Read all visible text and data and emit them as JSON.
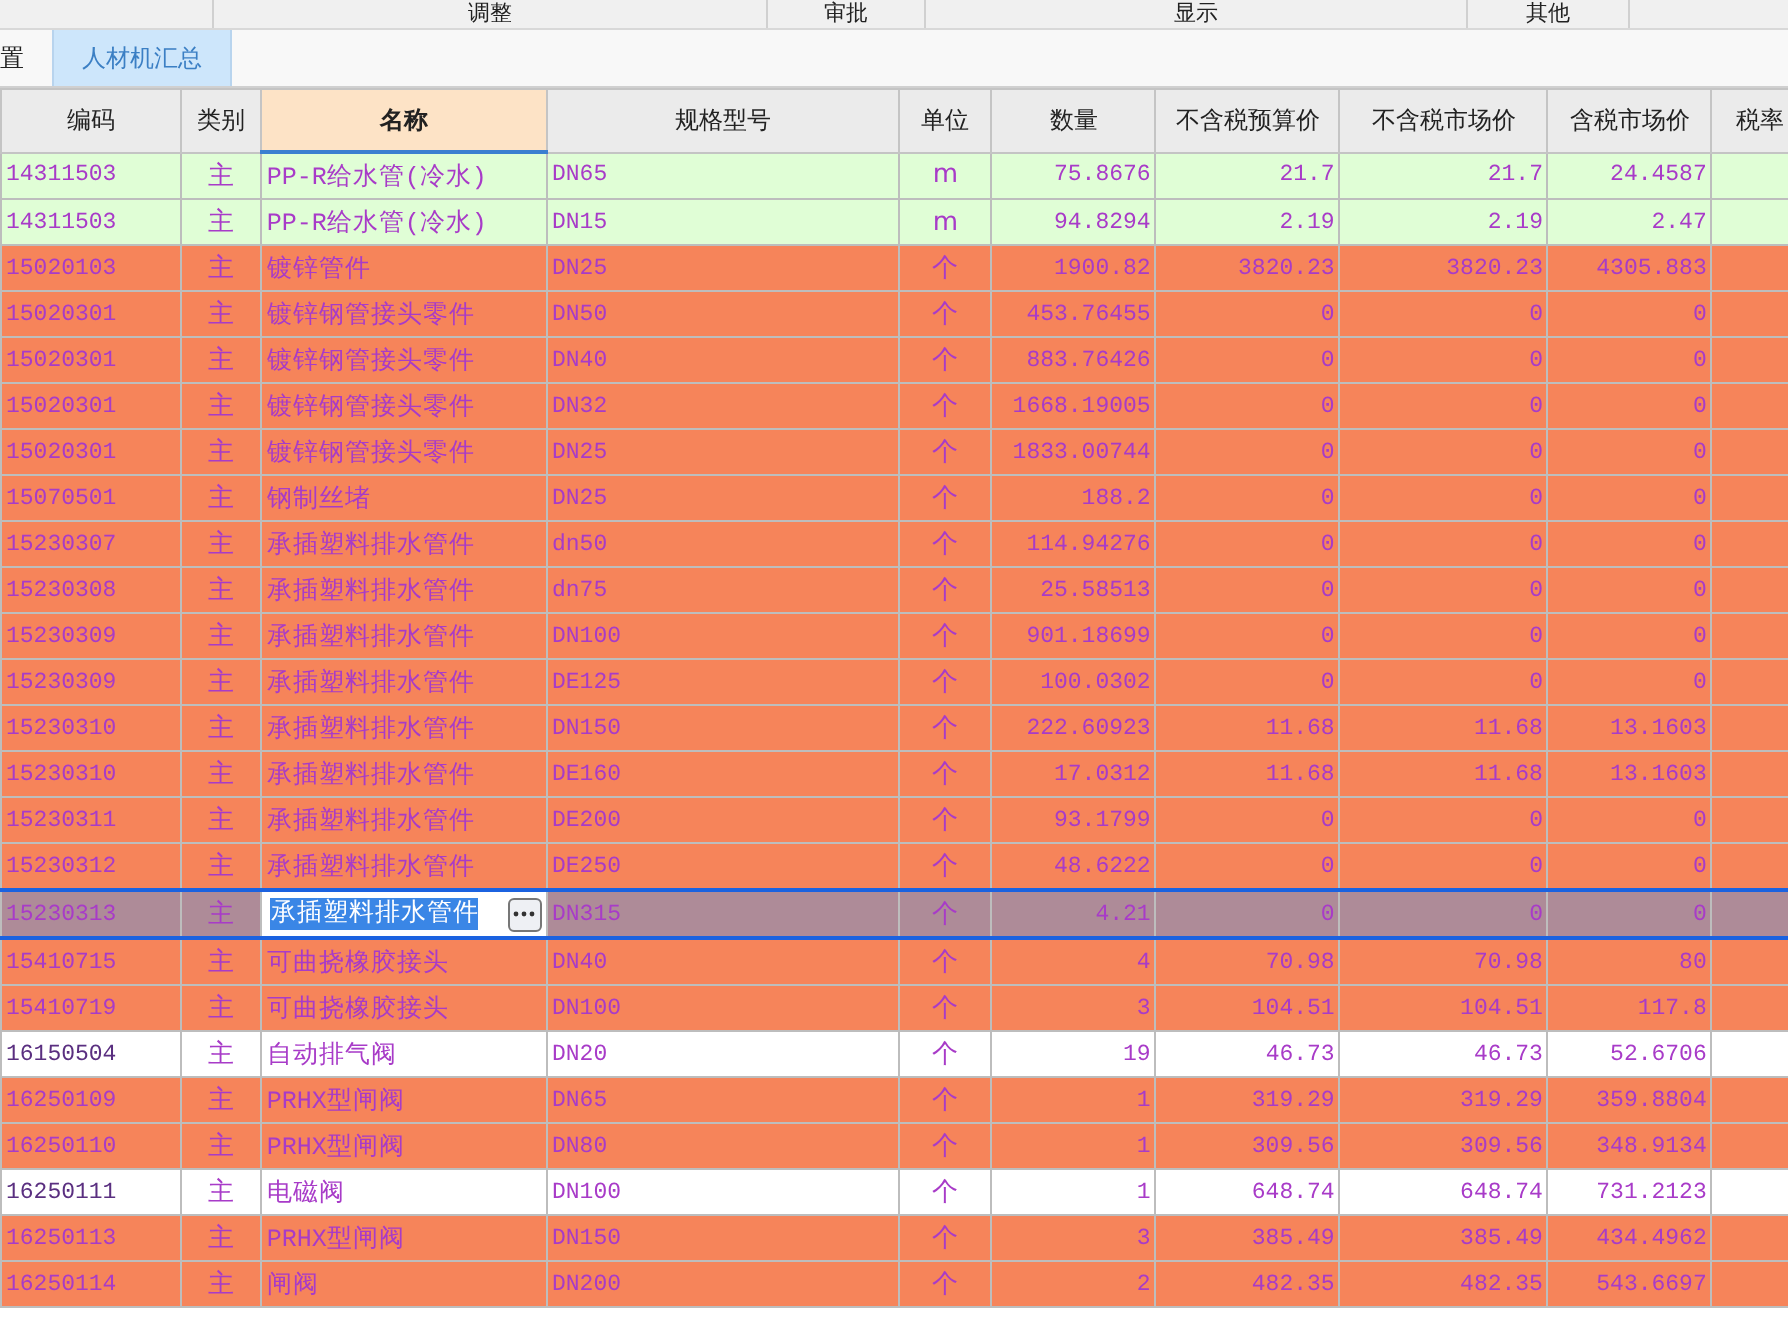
{
  "top_groups": [
    "调整",
    "审批",
    "显示",
    "其他"
  ],
  "tabs": [
    {
      "label": "置",
      "selected": false
    },
    {
      "label": "人材机汇总",
      "selected": true
    }
  ],
  "columns": [
    {
      "label": "编码",
      "selected": false
    },
    {
      "label": "类别",
      "selected": false
    },
    {
      "label": "名称",
      "selected": true
    },
    {
      "label": "规格型号",
      "selected": false
    },
    {
      "label": "单位",
      "selected": false
    },
    {
      "label": "数量",
      "selected": false
    },
    {
      "label": "不含税预算价",
      "selected": false
    },
    {
      "label": "不含税市场价",
      "selected": false
    },
    {
      "label": "含税市场价",
      "selected": false
    },
    {
      "label": "税率",
      "selected": false
    }
  ],
  "rows": [
    {
      "kind": "green",
      "selected": false,
      "cells": [
        "14311503",
        "主",
        "PP-R给水管(冷水)",
        "DN65",
        "m",
        "75.8676",
        "21.7",
        "21.7",
        "24.4587"
      ]
    },
    {
      "kind": "green",
      "selected": false,
      "cells": [
        "14311503",
        "主",
        "PP-R给水管(冷水)",
        "DN15",
        "m",
        "94.8294",
        "2.19",
        "2.19",
        "2.47"
      ]
    },
    {
      "kind": "orange",
      "selected": false,
      "cells": [
        "15020103",
        "主",
        "镀锌管件",
        "DN25",
        "个",
        "1900.82",
        "3820.23",
        "3820.23",
        "4305.883"
      ]
    },
    {
      "kind": "orange",
      "selected": false,
      "cells": [
        "15020301",
        "主",
        "镀锌钢管接头零件",
        "DN50",
        "个",
        "453.76455",
        "0",
        "0",
        "0"
      ]
    },
    {
      "kind": "orange",
      "selected": false,
      "cells": [
        "15020301",
        "主",
        "镀锌钢管接头零件",
        "DN40",
        "个",
        "883.76426",
        "0",
        "0",
        "0"
      ]
    },
    {
      "kind": "orange",
      "selected": false,
      "cells": [
        "15020301",
        "主",
        "镀锌钢管接头零件",
        "DN32",
        "个",
        "1668.19005",
        "0",
        "0",
        "0"
      ]
    },
    {
      "kind": "orange",
      "selected": false,
      "cells": [
        "15020301",
        "主",
        "镀锌钢管接头零件",
        "DN25",
        "个",
        "1833.00744",
        "0",
        "0",
        "0"
      ]
    },
    {
      "kind": "orange",
      "selected": false,
      "cells": [
        "15070501",
        "主",
        "钢制丝堵",
        "DN25",
        "个",
        "188.2",
        "0",
        "0",
        "0"
      ]
    },
    {
      "kind": "orange",
      "selected": false,
      "cells": [
        "15230307",
        "主",
        "承插塑料排水管件",
        "dn50",
        "个",
        "114.94276",
        "0",
        "0",
        "0"
      ]
    },
    {
      "kind": "orange",
      "selected": false,
      "cells": [
        "15230308",
        "主",
        "承插塑料排水管件",
        "dn75",
        "个",
        "25.58513",
        "0",
        "0",
        "0"
      ]
    },
    {
      "kind": "orange",
      "selected": false,
      "cells": [
        "15230309",
        "主",
        "承插塑料排水管件",
        "DN100",
        "个",
        "901.18699",
        "0",
        "0",
        "0"
      ]
    },
    {
      "kind": "orange",
      "selected": false,
      "cells": [
        "15230309",
        "主",
        "承插塑料排水管件",
        "DE125",
        "个",
        "100.0302",
        "0",
        "0",
        "0"
      ]
    },
    {
      "kind": "orange",
      "selected": false,
      "cells": [
        "15230310",
        "主",
        "承插塑料排水管件",
        "DN150",
        "个",
        "222.60923",
        "11.68",
        "11.68",
        "13.1603"
      ]
    },
    {
      "kind": "orange",
      "selected": false,
      "cells": [
        "15230310",
        "主",
        "承插塑料排水管件",
        "DE160",
        "个",
        "17.0312",
        "11.68",
        "11.68",
        "13.1603"
      ]
    },
    {
      "kind": "orange",
      "selected": false,
      "cells": [
        "15230311",
        "主",
        "承插塑料排水管件",
        "DE200",
        "个",
        "93.1799",
        "0",
        "0",
        "0"
      ]
    },
    {
      "kind": "orange",
      "selected": false,
      "cells": [
        "15230312",
        "主",
        "承插塑料排水管件",
        "DE250",
        "个",
        "48.6222",
        "0",
        "0",
        "0"
      ]
    },
    {
      "kind": "orange",
      "selected": true,
      "cells": [
        "15230313",
        "主",
        "承插塑料排水管件",
        "DN315",
        "个",
        "4.21",
        "0",
        "0",
        "0"
      ]
    },
    {
      "kind": "orange",
      "selected": false,
      "cells": [
        "15410715",
        "主",
        "可曲挠橡胶接头",
        "DN40",
        "个",
        "4",
        "70.98",
        "70.98",
        "80"
      ]
    },
    {
      "kind": "orange",
      "selected": false,
      "cells": [
        "15410719",
        "主",
        "可曲挠橡胶接头",
        "DN100",
        "个",
        "3",
        "104.51",
        "104.51",
        "117.8"
      ]
    },
    {
      "kind": "white",
      "selected": false,
      "cells": [
        "16150504",
        "主",
        "自动排气阀",
        "DN20",
        "个",
        "19",
        "46.73",
        "46.73",
        "52.6706"
      ]
    },
    {
      "kind": "orange",
      "selected": false,
      "cells": [
        "16250109",
        "主",
        "PRHX型闸阀",
        "DN65",
        "个",
        "1",
        "319.29",
        "319.29",
        "359.8804"
      ]
    },
    {
      "kind": "orange",
      "selected": false,
      "cells": [
        "16250110",
        "主",
        "PRHX型闸阀",
        "DN80",
        "个",
        "1",
        "309.56",
        "309.56",
        "348.9134"
      ]
    },
    {
      "kind": "white",
      "selected": false,
      "cells": [
        "16250111",
        "主",
        "电磁阀",
        "DN100",
        "个",
        "1",
        "648.74",
        "648.74",
        "731.2123"
      ]
    },
    {
      "kind": "orange",
      "selected": false,
      "cells": [
        "16250113",
        "主",
        "PRHX型闸阀",
        "DN150",
        "个",
        "3",
        "385.49",
        "385.49",
        "434.4962"
      ]
    },
    {
      "kind": "orange",
      "selected": false,
      "cells": [
        "16250114",
        "主",
        "闸阀",
        "DN200",
        "个",
        "2",
        "482.35",
        "482.35",
        "543.6697"
      ]
    }
  ]
}
